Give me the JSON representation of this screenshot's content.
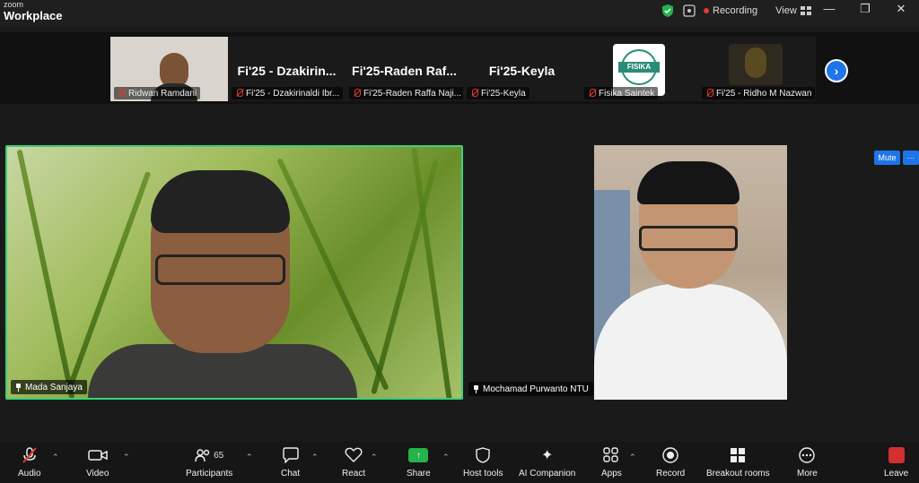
{
  "titlebar": {
    "brand_top": "zoom",
    "brand_main": "Workplace",
    "recording_label": "Recording",
    "view_label": "View"
  },
  "gallery": {
    "tiles": [
      {
        "name": "Ridwan Ramdani",
        "big": ""
      },
      {
        "name": "Fi'25 - Dzakirinaldi Ibr...",
        "big": "Fi'25 - Dzakirin..."
      },
      {
        "name": "Fi'25-Raden Raffa Naji...",
        "big": "Fi'25-Raden Raf..."
      },
      {
        "name": "Fi'25-Keyla",
        "big": "Fi'25-Keyla"
      },
      {
        "name": "Fisika Saintek",
        "big": ""
      },
      {
        "name": "Fi'25 - Ridho M Nazwan",
        "big": ""
      }
    ],
    "fisika_logo_text": "FISIKA"
  },
  "main": {
    "speaker_name": "Mada Sanjaya",
    "second_name": "Mochamad Purwanto NTU",
    "mute_label": "Mute",
    "more_label": "···"
  },
  "toolbar": {
    "audio": "Audio",
    "video": "Video",
    "participants": "Participants",
    "participants_count": "65",
    "chat": "Chat",
    "react": "React",
    "share": "Share",
    "host_tools": "Host tools",
    "ai_companion": "AI Companion",
    "apps": "Apps",
    "record": "Record",
    "breakout": "Breakout rooms",
    "more": "More",
    "leave": "Leave"
  },
  "colors": {
    "accent": "#1e74e8",
    "speaker_border": "#3ad07c",
    "share_green": "#24b34d",
    "leave_red": "#d32f2f",
    "record_red": "#e53935"
  }
}
